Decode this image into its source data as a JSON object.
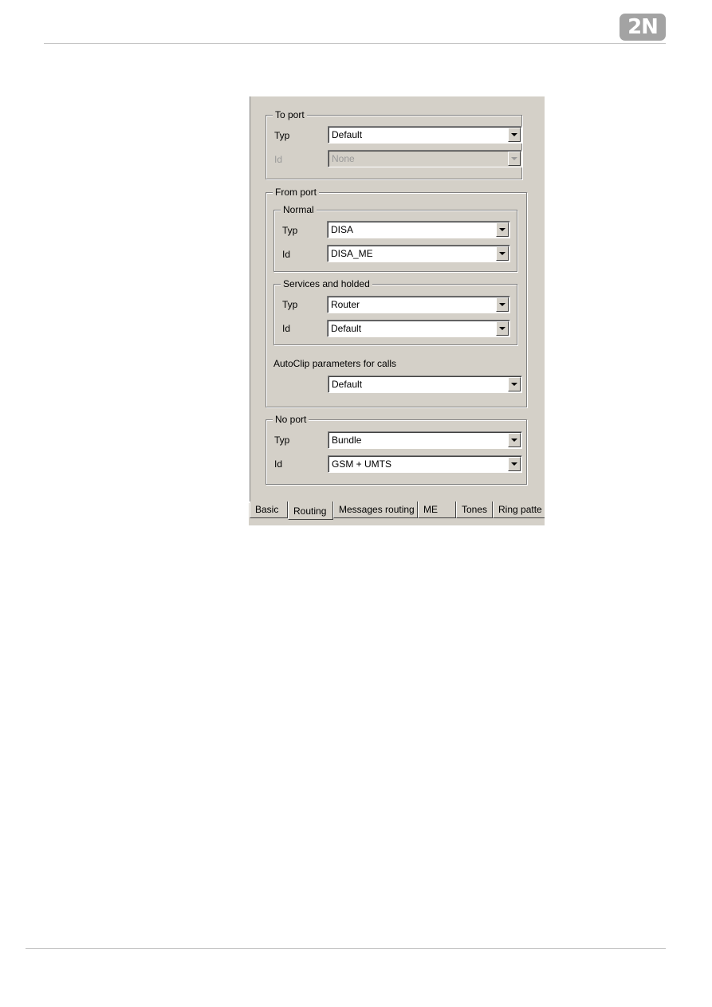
{
  "brand": {
    "logo_text": "2N",
    "logo_color": "#a3a3a3"
  },
  "dialog": {
    "to_port": {
      "title": "To port",
      "typ_label": "Typ",
      "typ_value": "Default",
      "id_label": "Id",
      "id_value": "None"
    },
    "from_port": {
      "title": "From port",
      "normal": {
        "title": "Normal",
        "typ_label": "Typ",
        "typ_value": "DISA",
        "id_label": "Id",
        "id_value": "DISA_ME"
      },
      "services": {
        "title": "Services and holded",
        "typ_label": "Typ",
        "typ_value": "Router",
        "id_label": "Id",
        "id_value": "Default"
      },
      "autoclip_label": "AutoClip parameters for calls",
      "autoclip_value": "Default"
    },
    "no_port": {
      "title": "No port",
      "typ_label": "Typ",
      "typ_value": "Bundle",
      "id_label": "Id",
      "id_value": "GSM + UMTS"
    },
    "tabs": [
      {
        "label": "Basic"
      },
      {
        "label": "Routing",
        "active": true
      },
      {
        "label": "Messages routing"
      },
      {
        "label": "ME"
      },
      {
        "label": "Tones"
      },
      {
        "label": "Ring patte"
      }
    ]
  }
}
